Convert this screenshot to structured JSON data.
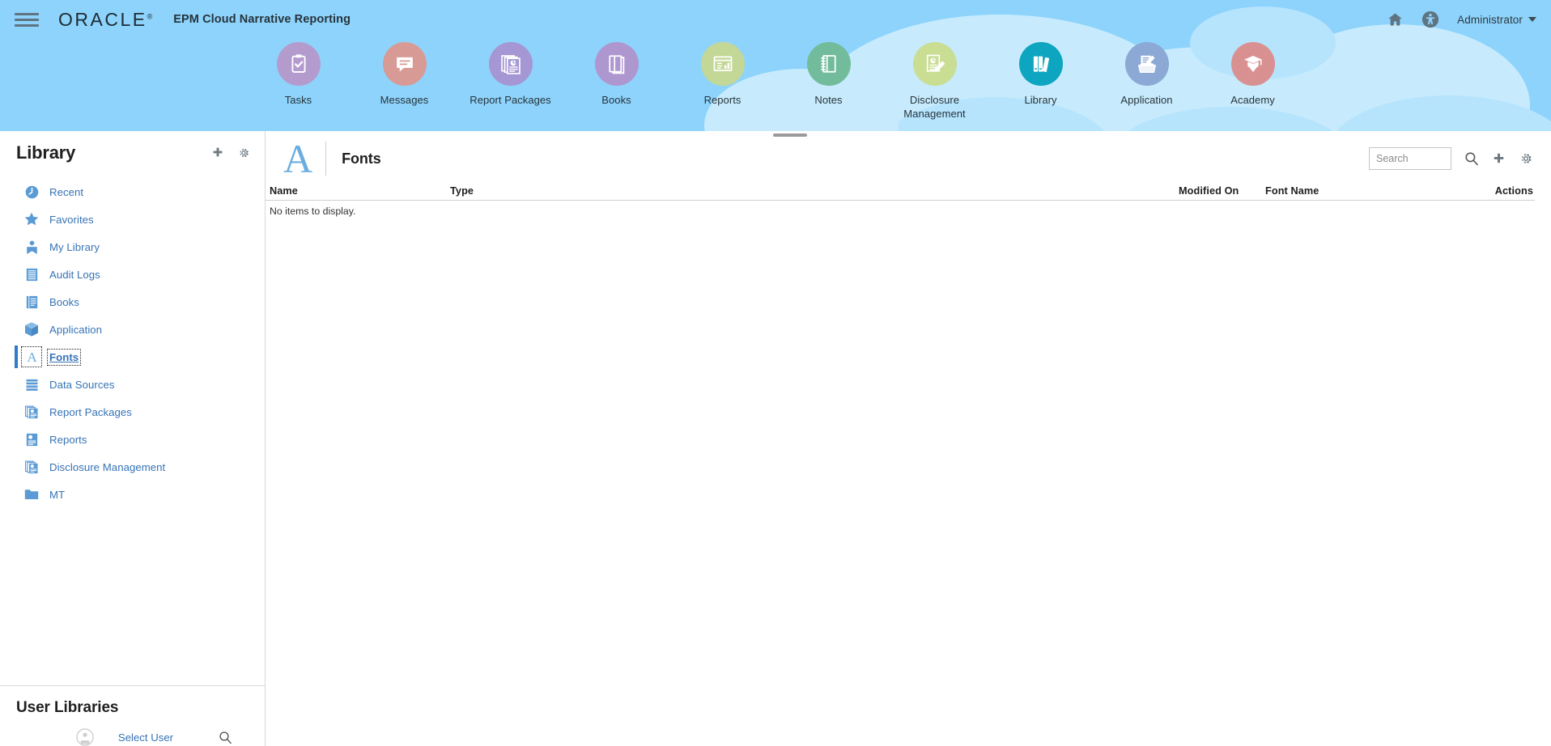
{
  "header": {
    "menu_icon": "hamburger-menu-icon",
    "logo_text": "ORACLE",
    "logo_mark": "®",
    "app_title": "EPM Cloud Narrative Reporting",
    "home_icon": "home-icon",
    "accessibility_icon": "accessibility-icon",
    "user_menu_label": "Administrator",
    "caret_icon": "chevron-down-icon"
  },
  "springboard": {
    "items": [
      {
        "label": "Tasks",
        "icon": "tasks-clipboard-icon",
        "color": "#b49bce",
        "active": false
      },
      {
        "label": "Messages",
        "icon": "messages-bubble-icon",
        "color": "#d89a94",
        "active": false
      },
      {
        "label": "Report Packages",
        "icon": "report-packages-icon",
        "color": "#a497d4",
        "active": false
      },
      {
        "label": "Books",
        "icon": "books-icon",
        "color": "#ae97cf",
        "active": false
      },
      {
        "label": "Reports",
        "icon": "reports-icon",
        "color": "#c3d796",
        "active": false
      },
      {
        "label": "Notes",
        "icon": "notes-notebook-icon",
        "color": "#72bc9b",
        "active": false
      },
      {
        "label": "Disclosure\nManagement",
        "icon": "disclosure-management-icon",
        "color": "#c9dd93",
        "active": false
      },
      {
        "label": "Library",
        "icon": "library-books-icon",
        "color": "#0ea5c0",
        "active": true
      },
      {
        "label": "Application",
        "icon": "application-box-icon",
        "color": "#8ba9d4",
        "active": false
      },
      {
        "label": "Academy",
        "icon": "academy-graduation-icon",
        "color": "#d99090",
        "active": false
      }
    ],
    "collapse_handle": "panel-collapse-handle"
  },
  "sidebar": {
    "title": "Library",
    "add_icon": "plus-icon",
    "settings_icon": "gear-icon",
    "items": [
      {
        "label": "Recent",
        "icon": "clock-icon",
        "selected": false
      },
      {
        "label": "Favorites",
        "icon": "star-icon",
        "selected": false
      },
      {
        "label": "My Library",
        "icon": "user-library-icon",
        "selected": false
      },
      {
        "label": "Audit Logs",
        "icon": "audit-log-icon",
        "selected": false
      },
      {
        "label": "Books",
        "icon": "book-icon",
        "selected": false
      },
      {
        "label": "Application",
        "icon": "cube-icon",
        "selected": false
      },
      {
        "label": "Fonts",
        "icon": "font-a-icon",
        "selected": true
      },
      {
        "label": "Data Sources",
        "icon": "data-sources-icon",
        "selected": false
      },
      {
        "label": "Report Packages",
        "icon": "report-packages-icon",
        "selected": false
      },
      {
        "label": "Reports",
        "icon": "report-icon",
        "selected": false
      },
      {
        "label": "Disclosure Management",
        "icon": "disclosure-icon",
        "selected": false
      },
      {
        "label": "MT",
        "icon": "folder-icon",
        "selected": false
      }
    ],
    "user_libraries": {
      "title": "User Libraries",
      "avatar_icon": "user-avatar-icon",
      "select_user_label": "Select User",
      "search_icon": "search-icon"
    }
  },
  "main": {
    "page_glyph": "A",
    "page_title": "Fonts",
    "toolbar": {
      "search_placeholder": "Search",
      "search_value": "",
      "search_icon": "search-icon",
      "add_icon": "plus-icon",
      "settings_icon": "gear-icon"
    },
    "table": {
      "columns": [
        "Name",
        "Type",
        "Modified On",
        "Font Name",
        "Actions"
      ],
      "rows": [],
      "empty_message": "No items to display."
    }
  },
  "colors": {
    "banner": "#8ed3fb",
    "cloud_light": "#c7ebfd",
    "accent_link": "#3673b5",
    "selected_bar": "#2e7ccc",
    "icon_gray": "#5f7481",
    "library_active": "#0ea5c0"
  }
}
